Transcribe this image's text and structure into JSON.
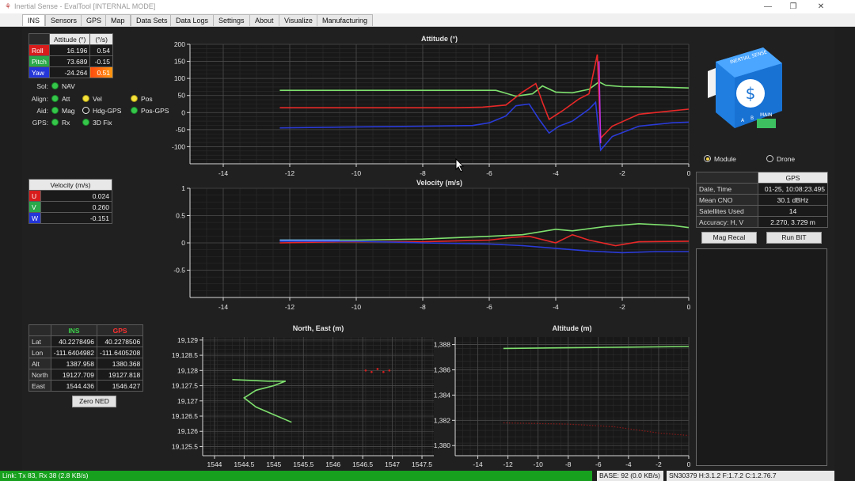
{
  "window": {
    "title": "Inertial Sense - EvalTool [INTERNAL MODE]",
    "minimize": "—",
    "maximize": "❐",
    "close": "✕"
  },
  "tabs": [
    {
      "label": "INS",
      "active": true
    },
    {
      "label": "Sensors"
    },
    {
      "label": "GPS"
    },
    {
      "label": "Map"
    },
    {
      "label": "Data Sets"
    },
    {
      "label": "Data Logs"
    },
    {
      "label": "Settings"
    },
    {
      "label": "About"
    },
    {
      "label": "Visualize"
    },
    {
      "label": "Manufacturing"
    }
  ],
  "attitude_table": {
    "col1": "Attitude (°)",
    "col2": "(°/s)",
    "rows": [
      {
        "label": "Roll",
        "value": "16.196",
        "rate": "0.54"
      },
      {
        "label": "Pitch",
        "value": "73.689",
        "rate": "-0.15"
      },
      {
        "label": "Yaw",
        "value": "-24.264",
        "rate": "0.51"
      }
    ]
  },
  "status": {
    "sol_label": "Sol:",
    "sol": {
      "label": "NAV",
      "color": "green"
    },
    "align_label": "Align:",
    "align": [
      {
        "label": "Att",
        "color": "green"
      },
      {
        "label": "Vel",
        "color": "yellow"
      },
      {
        "label": "Pos",
        "color": "yellow"
      }
    ],
    "aid_label": "Aid:",
    "aid": [
      {
        "label": "Mag",
        "color": "green"
      },
      {
        "label": "Hdg-GPS",
        "color": "white"
      },
      {
        "label": "Pos-GPS",
        "color": "green"
      }
    ],
    "gps_label": "GPS:",
    "gps": [
      {
        "label": "Rx",
        "color": "green"
      },
      {
        "label": "3D Fix",
        "color": "green"
      }
    ]
  },
  "velocity_table": {
    "title": "Velocity (m/s)",
    "rows": [
      {
        "label": "U",
        "value": "0.024"
      },
      {
        "label": "V",
        "value": "0.260"
      },
      {
        "label": "W",
        "value": "-0.151"
      }
    ]
  },
  "position_table": {
    "col_ins": "INS",
    "col_gps": "GPS",
    "rows": [
      {
        "label": "Lat",
        "ins": "40.2278496",
        "gps": "40.2278506"
      },
      {
        "label": "Lon",
        "ins": "-111.6404982",
        "gps": "-111.6405208"
      },
      {
        "label": "Alt",
        "ins": "1387.958",
        "gps": "1380.368"
      },
      {
        "label": "North",
        "ins": "19127.709",
        "gps": "19127.818"
      },
      {
        "label": "East",
        "ins": "1544.436",
        "gps": "1546.427"
      }
    ]
  },
  "zero_ned_button": "Zero NED",
  "mode": {
    "module": "Module",
    "drone": "Drone",
    "selected": "Module"
  },
  "gps_info": {
    "header": "GPS",
    "rows": [
      {
        "label": "Date, Time",
        "value": "01-25, 10:08:23.495"
      },
      {
        "label": "Mean CNO",
        "value": "30.1 dBHz"
      },
      {
        "label": "Satellites Used",
        "value": "14"
      },
      {
        "label": "Accuracy: H, V",
        "value": "2.270, 3.729 m"
      }
    ]
  },
  "mag_recal_button": "Mag Recal",
  "run_bit_button": "Run BIT",
  "device": {
    "brand_text": "INERTIAL SENSE",
    "label_a": "A",
    "label_b": "B",
    "label_main": "MAIN"
  },
  "statusbar": {
    "link": "Link: Tx 83, Rx 38  (2.8 KB/s)",
    "base": "BASE: 92  (0.0 KB/s)",
    "serial": "SN30379  H:3.1.2  F:1.7.2  C:1.2.76.7"
  },
  "colors": {
    "roll": "#e82828",
    "pitch": "#7ee06e",
    "yaw": "#2a3bd8",
    "magenta": "#c030e0",
    "gps_track": "#d42020"
  },
  "chart_data": [
    {
      "type": "line",
      "title": "Attitude (°)",
      "xlim": [
        -15,
        0
      ],
      "ylim": [
        -150,
        200
      ],
      "xticks": [
        -14,
        -12,
        -10,
        -8,
        -6,
        -4,
        -2,
        0
      ],
      "yticks": [
        200,
        150,
        100,
        50,
        0,
        -50,
        -100
      ],
      "grid": true,
      "series": [
        {
          "color": "#7ee06e",
          "points": [
            [
              -12.3,
              65
            ],
            [
              -7,
              65
            ],
            [
              -5.8,
              65
            ],
            [
              -5.2,
              48
            ],
            [
              -4.7,
              55
            ],
            [
              -4.4,
              78
            ],
            [
              -4.0,
              60
            ],
            [
              -3.5,
              58
            ],
            [
              -3.0,
              68
            ],
            [
              -2.7,
              90
            ],
            [
              -2.5,
              80
            ],
            [
              -2.0,
              76
            ],
            [
              -1.0,
              75
            ],
            [
              0,
              72
            ]
          ]
        },
        {
          "color": "#e82828",
          "points": [
            [
              -12.3,
              14
            ],
            [
              -7,
              14
            ],
            [
              -6.2,
              16
            ],
            [
              -5.5,
              22
            ],
            [
              -5.0,
              60
            ],
            [
              -4.6,
              85
            ],
            [
              -4.4,
              30
            ],
            [
              -4.2,
              -20
            ],
            [
              -3.8,
              5
            ],
            [
              -3.3,
              40
            ],
            [
              -3.0,
              55
            ],
            [
              -2.75,
              170
            ],
            [
              -2.65,
              -75
            ],
            [
              -2.3,
              -40
            ],
            [
              -1.5,
              -5
            ],
            [
              -0.5,
              5
            ],
            [
              0,
              10
            ]
          ]
        },
        {
          "color": "#2a3bd8",
          "points": [
            [
              -12.3,
              -45
            ],
            [
              -10,
              -42
            ],
            [
              -8,
              -40
            ],
            [
              -6.5,
              -38
            ],
            [
              -6.0,
              -30
            ],
            [
              -5.5,
              -10
            ],
            [
              -5.2,
              20
            ],
            [
              -4.8,
              25
            ],
            [
              -4.5,
              -20
            ],
            [
              -4.2,
              -60
            ],
            [
              -3.9,
              -40
            ],
            [
              -3.5,
              -25
            ],
            [
              -3.0,
              10
            ],
            [
              -2.8,
              30
            ],
            [
              -2.65,
              -110
            ],
            [
              -2.3,
              -70
            ],
            [
              -1.5,
              -40
            ],
            [
              -0.5,
              -30
            ],
            [
              0,
              -28
            ]
          ]
        },
        {
          "color": "#c030e0",
          "points": [
            [
              -2.7,
              150
            ],
            [
              -2.65,
              -90
            ]
          ]
        }
      ]
    },
    {
      "type": "line",
      "title": "Velocity (m/s)",
      "xlim": [
        -15,
        0
      ],
      "ylim": [
        -1.0,
        1.0
      ],
      "xticks": [
        -14,
        -12,
        -10,
        -8,
        -6,
        -4,
        -2,
        0
      ],
      "yticks": [
        1,
        0.5,
        0,
        -0.5
      ],
      "grid": true,
      "series": [
        {
          "color": "#7ee06e",
          "points": [
            [
              -12.3,
              0.05
            ],
            [
              -10,
              0.05
            ],
            [
              -8,
              0.07
            ],
            [
              -6,
              0.12
            ],
            [
              -5,
              0.15
            ],
            [
              -4,
              0.25
            ],
            [
              -3.5,
              0.22
            ],
            [
              -2.5,
              0.3
            ],
            [
              -1.5,
              0.35
            ],
            [
              -0.5,
              0.32
            ],
            [
              0,
              0.28
            ]
          ]
        },
        {
          "color": "#e82828",
          "points": [
            [
              -12.3,
              0.0
            ],
            [
              -10.5,
              0.02
            ],
            [
              -8,
              0.02
            ],
            [
              -6,
              0.05
            ],
            [
              -5.3,
              0.1
            ],
            [
              -4.8,
              0.12
            ],
            [
              -4.0,
              0.0
            ],
            [
              -3.5,
              0.15
            ],
            [
              -3.0,
              0.05
            ],
            [
              -2.2,
              -0.05
            ],
            [
              -1.5,
              0.02
            ],
            [
              0,
              0.03
            ]
          ]
        },
        {
          "color": "#2a3bd8",
          "points": [
            [
              -12.3,
              0.03
            ],
            [
              -10,
              0.03
            ],
            [
              -8,
              0.0
            ],
            [
              -6,
              -0.02
            ],
            [
              -5,
              -0.05
            ],
            [
              -4,
              -0.1
            ],
            [
              -3,
              -0.15
            ],
            [
              -2,
              -0.18
            ],
            [
              -1,
              -0.16
            ],
            [
              0,
              -0.16
            ]
          ]
        },
        {
          "color": "#6fa4ff",
          "points": [
            [
              -12.3,
              0.05
            ],
            [
              -10.5,
              0.05
            ]
          ]
        }
      ]
    },
    {
      "type": "scatter",
      "title": "North, East (m)",
      "xlim": [
        1543.8,
        1547.7
      ],
      "ylim": [
        19125.2,
        19129.1
      ],
      "xticks": [
        1544,
        1544.5,
        1545,
        1545.5,
        1546,
        1546.5,
        1547,
        1547.5
      ],
      "yticks": [
        19129,
        19128.5,
        19128,
        19127.5,
        19127,
        19126.5,
        19126,
        19125.5
      ],
      "ytick_labels": [
        "19,129",
        "19,128.5",
        "19,128",
        "19,127.5",
        "19,127",
        "19,126.5",
        "19,126",
        "19,125.5"
      ],
      "grid": true,
      "series": [
        {
          "color": "#7ee06e",
          "mode": "line",
          "points": [
            [
              1544.3,
              19127.7
            ],
            [
              1544.9,
              19127.65
            ],
            [
              1545.2,
              19127.65
            ],
            [
              1545.0,
              19127.5
            ],
            [
              1544.7,
              19127.35
            ],
            [
              1544.5,
              19127.1
            ],
            [
              1544.7,
              19126.8
            ],
            [
              1545.0,
              19126.55
            ],
            [
              1545.3,
              19126.3
            ]
          ]
        },
        {
          "color": "#d42020",
          "mode": "dots",
          "points": [
            [
              1546.55,
              19128.0
            ],
            [
              1546.65,
              19127.95
            ],
            [
              1546.75,
              19128.05
            ],
            [
              1546.85,
              19127.95
            ],
            [
              1546.95,
              19128.0
            ]
          ]
        }
      ]
    },
    {
      "type": "line",
      "title": "Altitude (m)",
      "xlim": [
        -15.5,
        0
      ],
      "ylim": [
        1379.2,
        1388.6
      ],
      "xticks": [
        -14,
        -12,
        -10,
        -8,
        -6,
        -4,
        -2,
        0
      ],
      "yticks": [
        1388,
        1386,
        1384,
        1382,
        1380
      ],
      "ytick_labels": [
        "1,388",
        "1,386",
        "1,384",
        "1,382",
        "1,380"
      ],
      "grid": true,
      "series": [
        {
          "color": "#7ee06e",
          "points": [
            [
              -12.3,
              1387.7
            ],
            [
              -8,
              1387.75
            ],
            [
              -4,
              1387.8
            ],
            [
              0,
              1387.85
            ]
          ]
        },
        {
          "color": "#8a1a1a",
          "dashed": true,
          "points": [
            [
              -12.3,
              1381.8
            ],
            [
              -8,
              1381.7
            ],
            [
              -5,
              1381.5
            ],
            [
              -2,
              1381.0
            ],
            [
              0,
              1380.8
            ]
          ]
        }
      ]
    }
  ]
}
